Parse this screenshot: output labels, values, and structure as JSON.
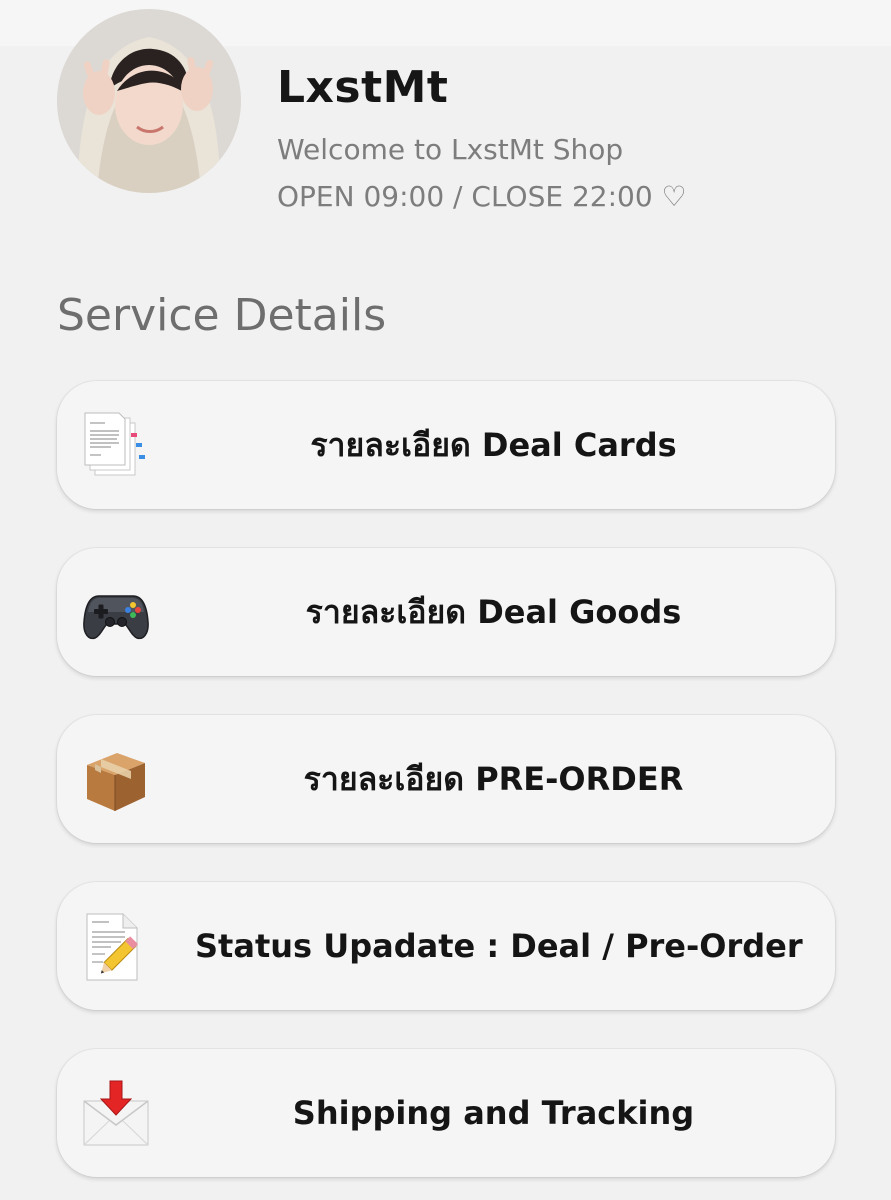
{
  "profile": {
    "name": "LxstMt",
    "welcome": "Welcome to LxstMt Shop",
    "hours": "OPEN 09:00 / CLOSE 22:00 ♡"
  },
  "section_title": "Service Details",
  "services": [
    {
      "label": "รายละเอียด Deal Cards",
      "icon": "documents-icon"
    },
    {
      "label": "รายละเอียด Deal Goods",
      "icon": "gamepad-icon"
    },
    {
      "label": "รายละเอียด PRE-ORDER",
      "icon": "package-icon"
    },
    {
      "label": "Status Upadate : Deal / Pre-Order",
      "icon": "memo-pencil-icon"
    },
    {
      "label": "Shipping and Tracking",
      "icon": "incoming-envelope-icon"
    }
  ],
  "colors": {
    "background": "#f2f1f1",
    "button": "#f6f5f5",
    "title_text": "#161616",
    "muted_text": "#7d7d7d"
  }
}
